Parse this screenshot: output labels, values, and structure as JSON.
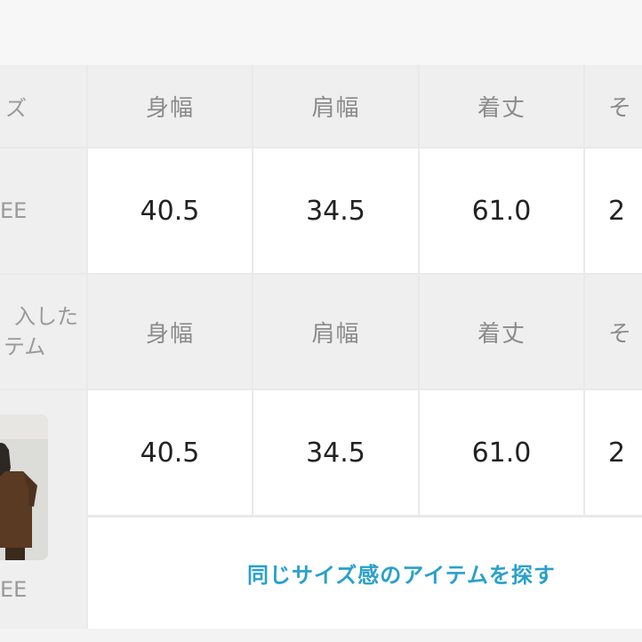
{
  "header_row_1": {
    "size_label_partial": "ズ",
    "columns": [
      "身幅",
      "肩幅",
      "着丈",
      "そ"
    ]
  },
  "value_row_1": {
    "size_name_partial": "EE",
    "values": [
      "40.5",
      "34.5",
      "61.0",
      "2"
    ]
  },
  "header_row_2": {
    "purchased_label_line1": "入した",
    "purchased_label_line2": "テム",
    "columns": [
      "身幅",
      "肩幅",
      "着丈",
      "そ"
    ]
  },
  "value_row_2": {
    "item_size_partial": "EE",
    "values": [
      "40.5",
      "34.5",
      "61.0",
      "2"
    ],
    "thumbnail_icon": "product-photo-thumbnail"
  },
  "search_link": "同じサイズ感のアイテムを探す",
  "colors": {
    "header_bg": "#efefef",
    "cell_bg": "#ffffff",
    "grid": "#e9e9e9",
    "link": "#2aa0cc"
  }
}
